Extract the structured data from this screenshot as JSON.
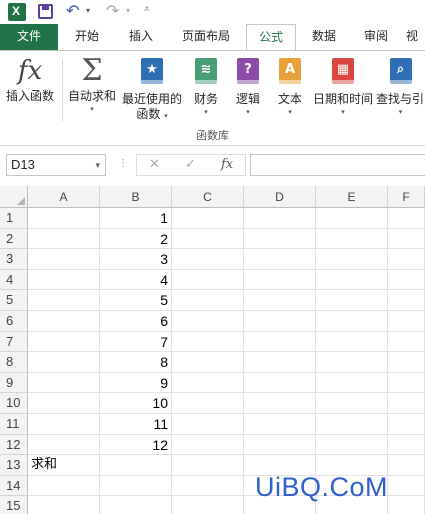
{
  "quick_access": {
    "icons": [
      "excel-logo-icon",
      "save-icon",
      "undo-icon",
      "redo-icon",
      "customize-icon"
    ]
  },
  "tabs": [
    {
      "label": "文件"
    },
    {
      "label": "开始"
    },
    {
      "label": "插入"
    },
    {
      "label": "页面布局"
    },
    {
      "label": "公式",
      "active": true
    },
    {
      "label": "数据"
    },
    {
      "label": "审阅"
    },
    {
      "label": "视"
    }
  ],
  "ribbon": {
    "group_label": "函数库",
    "buttons": [
      {
        "label": "插入函数",
        "icon": "fx-icon"
      },
      {
        "label": "自动求和",
        "icon": "sigma-icon"
      },
      {
        "label": "最近使用的",
        "label2": "函数",
        "icon": "star-book-icon",
        "color": "#2f6eb5"
      },
      {
        "label": "财务",
        "icon": "coins-book-icon",
        "color": "#4a9e75"
      },
      {
        "label": "逻辑",
        "icon": "question-book-icon",
        "color": "#8e4aa8"
      },
      {
        "label": "文本",
        "icon": "text-book-icon",
        "color": "#e8a13a"
      },
      {
        "label": "日期和时间",
        "icon": "calendar-book-icon",
        "color": "#d9473f"
      },
      {
        "label": "查找与引",
        "icon": "search-book-icon",
        "color": "#2f6eb5"
      }
    ]
  },
  "formula_bar": {
    "name_box": "D13",
    "cancel_symbol": "✕",
    "enter_symbol": "✓",
    "fx_symbol": "fx",
    "content": ""
  },
  "sheet": {
    "columns": [
      "A",
      "B",
      "C",
      "D",
      "E",
      "F"
    ],
    "rows": [
      {
        "num": "1",
        "a": "",
        "b": "1"
      },
      {
        "num": "2",
        "a": "",
        "b": "2"
      },
      {
        "num": "3",
        "a": "",
        "b": "3"
      },
      {
        "num": "4",
        "a": "",
        "b": "4"
      },
      {
        "num": "5",
        "a": "",
        "b": "5"
      },
      {
        "num": "6",
        "a": "",
        "b": "6"
      },
      {
        "num": "7",
        "a": "",
        "b": "7"
      },
      {
        "num": "8",
        "a": "",
        "b": "8"
      },
      {
        "num": "9",
        "a": "",
        "b": "9"
      },
      {
        "num": "10",
        "a": "",
        "b": "10"
      },
      {
        "num": "11",
        "a": "",
        "b": "11"
      },
      {
        "num": "12",
        "a": "",
        "b": "12"
      },
      {
        "num": "13",
        "a": "求和",
        "b": ""
      },
      {
        "num": "14",
        "a": "",
        "b": ""
      },
      {
        "num": "15",
        "a": "",
        "b": ""
      }
    ]
  },
  "watermark": "UiBQ.CoM"
}
